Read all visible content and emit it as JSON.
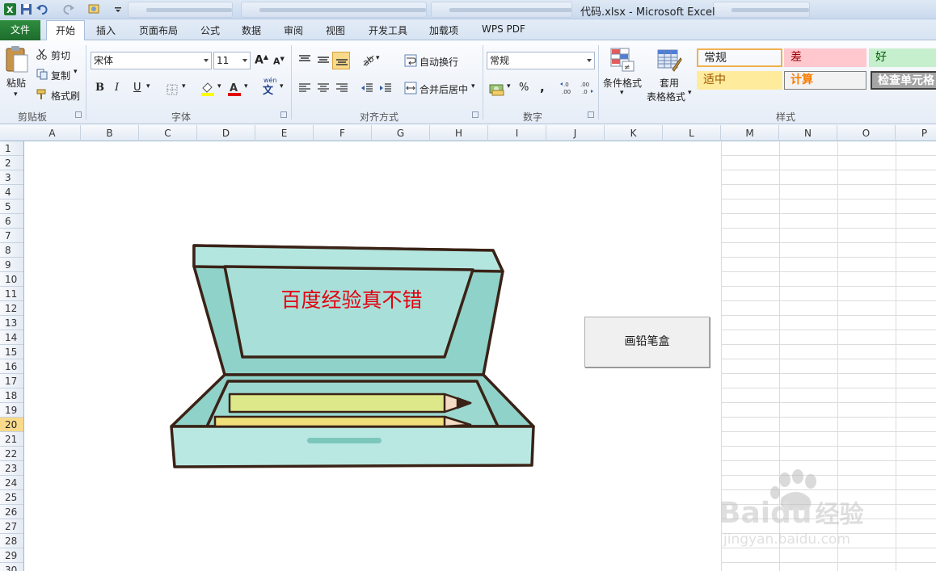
{
  "window": {
    "title": "代码.xlsx - Microsoft Excel"
  },
  "tabs": [
    "文件",
    "开始",
    "插入",
    "页面布局",
    "公式",
    "数据",
    "审阅",
    "视图",
    "开发工具",
    "加载项",
    "WPS PDF"
  ],
  "clipboard": {
    "paste": "粘贴",
    "cut": "剪切",
    "copy": "复制",
    "format_painter": "格式刷",
    "group": "剪贴板"
  },
  "font": {
    "name": "宋体",
    "size": "11",
    "group": "字体",
    "bold": "B",
    "italic": "I",
    "underline": "U",
    "wen": "wén"
  },
  "alignment": {
    "wrap": "自动换行",
    "merge": "合并后居中",
    "group": "对齐方式"
  },
  "number": {
    "format": "常规",
    "percent": "%",
    "comma": ",",
    "inc": "←.0\n.00",
    "dec": ".00\n→.0",
    "group": "数字"
  },
  "styles": {
    "cond_format": "条件格式",
    "table_format_1": "套用",
    "table_format_2": "表格格式",
    "group": "样式",
    "cells": [
      {
        "label": "常规",
        "bg": "#ffffff",
        "fg": "#000000",
        "border": "#f0b04f"
      },
      {
        "label": "差",
        "bg": "#ffc7ce",
        "fg": "#9c0006",
        "border": "#ffc7ce"
      },
      {
        "label": "好",
        "bg": "#c6efce",
        "fg": "#006100",
        "border": "#c6efce"
      },
      {
        "label": "适中",
        "bg": "#ffeb9c",
        "fg": "#9c5700",
        "border": "#ffeb9c"
      },
      {
        "label": "计算",
        "bg": "#f2f2f2",
        "fg": "#fa7d00",
        "border": "#7f7f7f"
      },
      {
        "label": "检查单元格",
        "bg": "#a5a5a5",
        "fg": "#ffffff",
        "border": "#3f3f3f"
      }
    ]
  },
  "columns": [
    "A",
    "B",
    "C",
    "D",
    "E",
    "F",
    "G",
    "H",
    "I",
    "J",
    "K",
    "L",
    "M",
    "N",
    "O",
    "P"
  ],
  "rows": [
    "1",
    "2",
    "3",
    "4",
    "5",
    "6",
    "7",
    "8",
    "9",
    "10",
    "11",
    "12",
    "13",
    "14",
    "15",
    "16",
    "17",
    "18",
    "19",
    "20",
    "21",
    "22",
    "23",
    "24",
    "25",
    "26",
    "27",
    "28",
    "29",
    "30"
  ],
  "selected_row": "20",
  "drawing": {
    "caption": "百度经验真不错"
  },
  "button": {
    "label": "画铅笔盒"
  },
  "watermark": {
    "brand": "Baidu",
    "suffix": "经验",
    "url": "jingyan.baidu.com"
  },
  "colors": {
    "accent_green": "#1e6b2c",
    "box_fill": "#a3ddd6",
    "box_outline": "#3a2216",
    "pencil_yellow": "#dde88a",
    "caption_red": "#e3000f"
  }
}
